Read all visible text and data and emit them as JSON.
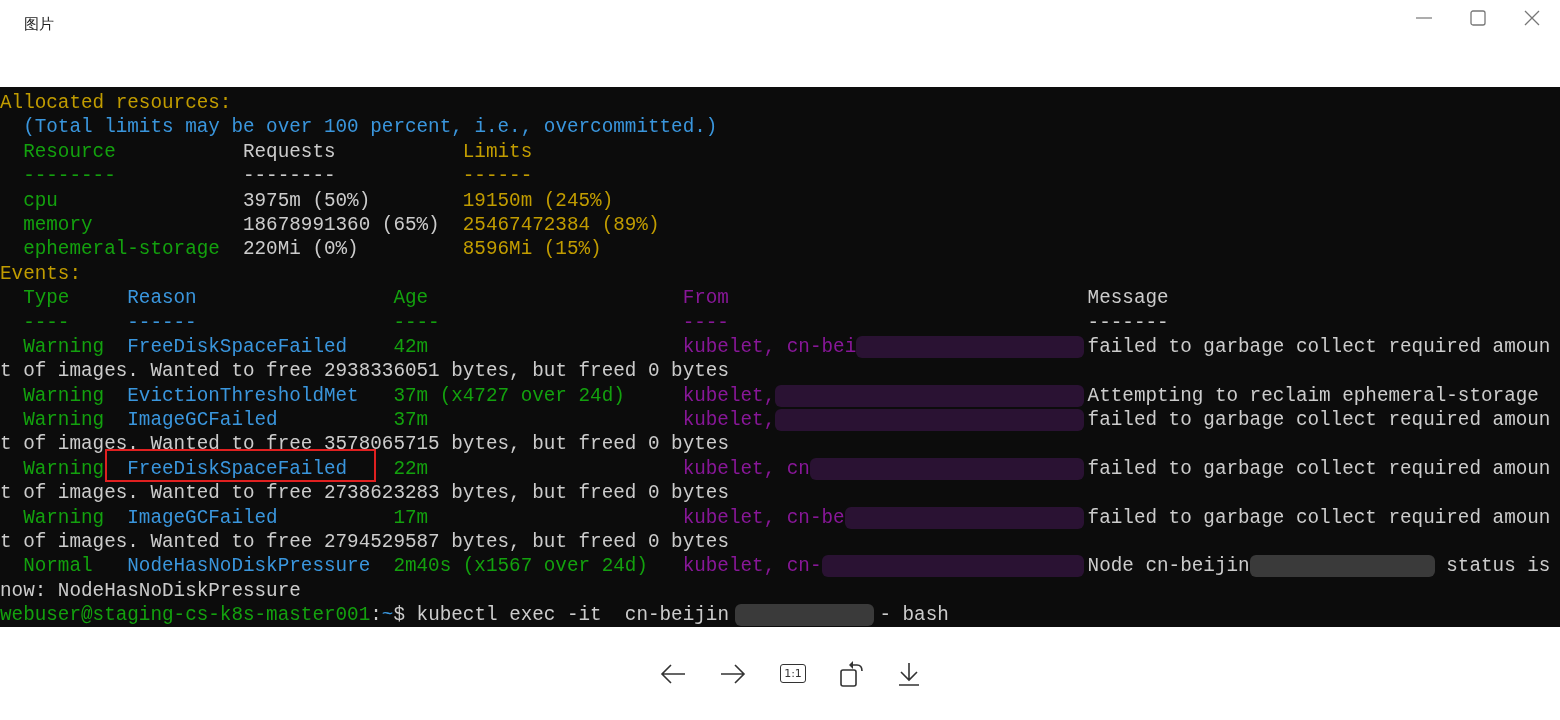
{
  "window": {
    "title": "图片"
  },
  "terminal": {
    "header": "Allocated resources:",
    "note": "(Total limits may be over 100 percent, i.e., overcommitted.)",
    "resources": {
      "columns": [
        {
          "label": "Resource",
          "rule": "--------"
        },
        {
          "label": "Requests",
          "rule": "--------"
        },
        {
          "label": "Limits",
          "rule": "------"
        }
      ],
      "rows": [
        [
          "cpu",
          "3975m (50%)",
          "19150m (245%)"
        ],
        [
          "memory",
          "18678991360 (65%)",
          "25467472384 (89%)"
        ],
        [
          "ephemeral-storage",
          "220Mi (0%)",
          "8596Mi (15%)"
        ]
      ]
    },
    "events_header": "Events:",
    "events": {
      "columns": [
        {
          "label": "Type",
          "rule": "----"
        },
        {
          "label": "Reason",
          "rule": "------"
        },
        {
          "label": "Age",
          "rule": "----"
        },
        {
          "label": "From",
          "rule": "----"
        },
        {
          "label": "Message",
          "rule": "-------"
        }
      ],
      "rows": [
        {
          "type": "Warning",
          "reason": "FreeDiskSpaceFailed",
          "age": "42m",
          "from": "kubelet, cn-bei",
          "from_redacted": true,
          "message": "failed to garbage collect required amoun",
          "continuation": "t of images. Wanted to free 2938336051 bytes, but freed 0 bytes",
          "highlighted": false
        },
        {
          "type": "Warning",
          "reason": "EvictionThresholdMet",
          "age": "37m (x4727 over 24d)",
          "from": "kubelet,",
          "from_redacted": true,
          "message": "Attempting to reclaim ephemeral-storage",
          "highlighted": false
        },
        {
          "type": "Warning",
          "reason": "ImageGCFailed",
          "age": "37m",
          "from": "kubelet,",
          "from_redacted": true,
          "message": "failed to garbage collect required amoun",
          "continuation": "t of images. Wanted to free 3578065715 bytes, but freed 0 bytes",
          "highlighted": false
        },
        {
          "type": "Warning",
          "reason": "FreeDiskSpaceFailed",
          "age": "22m",
          "from": "kubelet, cn",
          "from_redacted": true,
          "message": "failed to garbage collect required amoun",
          "continuation": "t of images. Wanted to free 2738623283 bytes, but freed 0 bytes",
          "highlighted": true
        },
        {
          "type": "Warning",
          "reason": "ImageGCFailed",
          "age": "17m",
          "from": "kubelet, cn-be",
          "from_redacted": true,
          "message": "failed to garbage collect required amoun",
          "continuation": "t of images. Wanted to free 2794529587 bytes, but freed 0 bytes",
          "highlighted": false
        },
        {
          "type": "Normal",
          "reason": "NodeHasNoDiskPressure",
          "age": "2m40s (x1567 over 24d)",
          "from": "kubelet, cn-",
          "from_redacted": true,
          "message": "Node cn-beijin",
          "message_tail": "status is",
          "continuation": "now: NodeHasNoDiskPressure",
          "highlighted": false
        }
      ]
    },
    "prompt": {
      "user": "webuser@staging-cs-k8s-master001",
      "separator": ":",
      "path": "~",
      "command": "$ kubectl exec -it  cn-beijin",
      "command_tail": "- bash"
    }
  },
  "toolbar": [
    {
      "kind": "previous"
    },
    {
      "kind": "next"
    },
    {
      "kind": "actual-size",
      "label": "1:1"
    },
    {
      "kind": "rotate"
    },
    {
      "kind": "download"
    }
  ]
}
